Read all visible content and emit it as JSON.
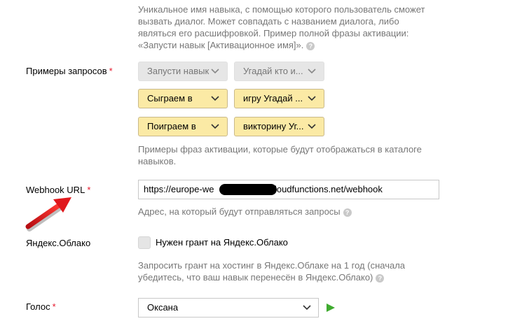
{
  "activation_name": {
    "hint_lines": [
      "Уникальное имя навыка, с помощью которого пользователь сможет",
      "вызвать диалог. Может совпадать с названием диалога, либо",
      "являться его расшифровкой. Пример полной фразы активации:",
      "«Запусти навык [Активационное имя]»."
    ]
  },
  "examples": {
    "label": "Примеры запросов",
    "required_mark": "*",
    "rows": [
      {
        "first": "Запусти навык",
        "second": "Угадай кто и...",
        "state": "disabled"
      },
      {
        "first": "Сыграем в",
        "second": "игру Угадай ...",
        "state": "active"
      },
      {
        "first": "Поиграем в",
        "second": "викторину Уг...",
        "state": "active"
      }
    ],
    "hint_lines": [
      "Примеры фраз активации, которые будут отображаться в каталоге",
      "навыков."
    ]
  },
  "webhook": {
    "label": "Webhook URL",
    "required_mark": "*",
    "value_start": "https://europe-we",
    "value_end": "cloudfunctions.net/webhook",
    "hint": "Адрес, на который будут отправляться запросы"
  },
  "cloud": {
    "label": "Яндекс.Облако",
    "checkbox_label": "Нужен грант на Яндекс.Облако",
    "checked": false,
    "hint_lines": [
      "Запросить грант на хостинг в Яндекс.Облаке на 1 год (сначала",
      "убедитесь, что ваш навык перенесён в Яндекс.Облако)"
    ]
  },
  "voice": {
    "label": "Голос",
    "required_mark": "*",
    "selected": "Оксана"
  },
  "icons": {
    "help": "question-circle-icon",
    "dropdown": "chevron-down-icon",
    "play": "play-icon",
    "annotation": "red-arrow"
  },
  "colors": {
    "required": "#e5172b",
    "pill_active_bg": "#fbeaa5",
    "pill_disabled_bg": "#e6e6e6",
    "play": "#3fab2f",
    "arrow": "#e0181c",
    "redaction": "#000000"
  }
}
